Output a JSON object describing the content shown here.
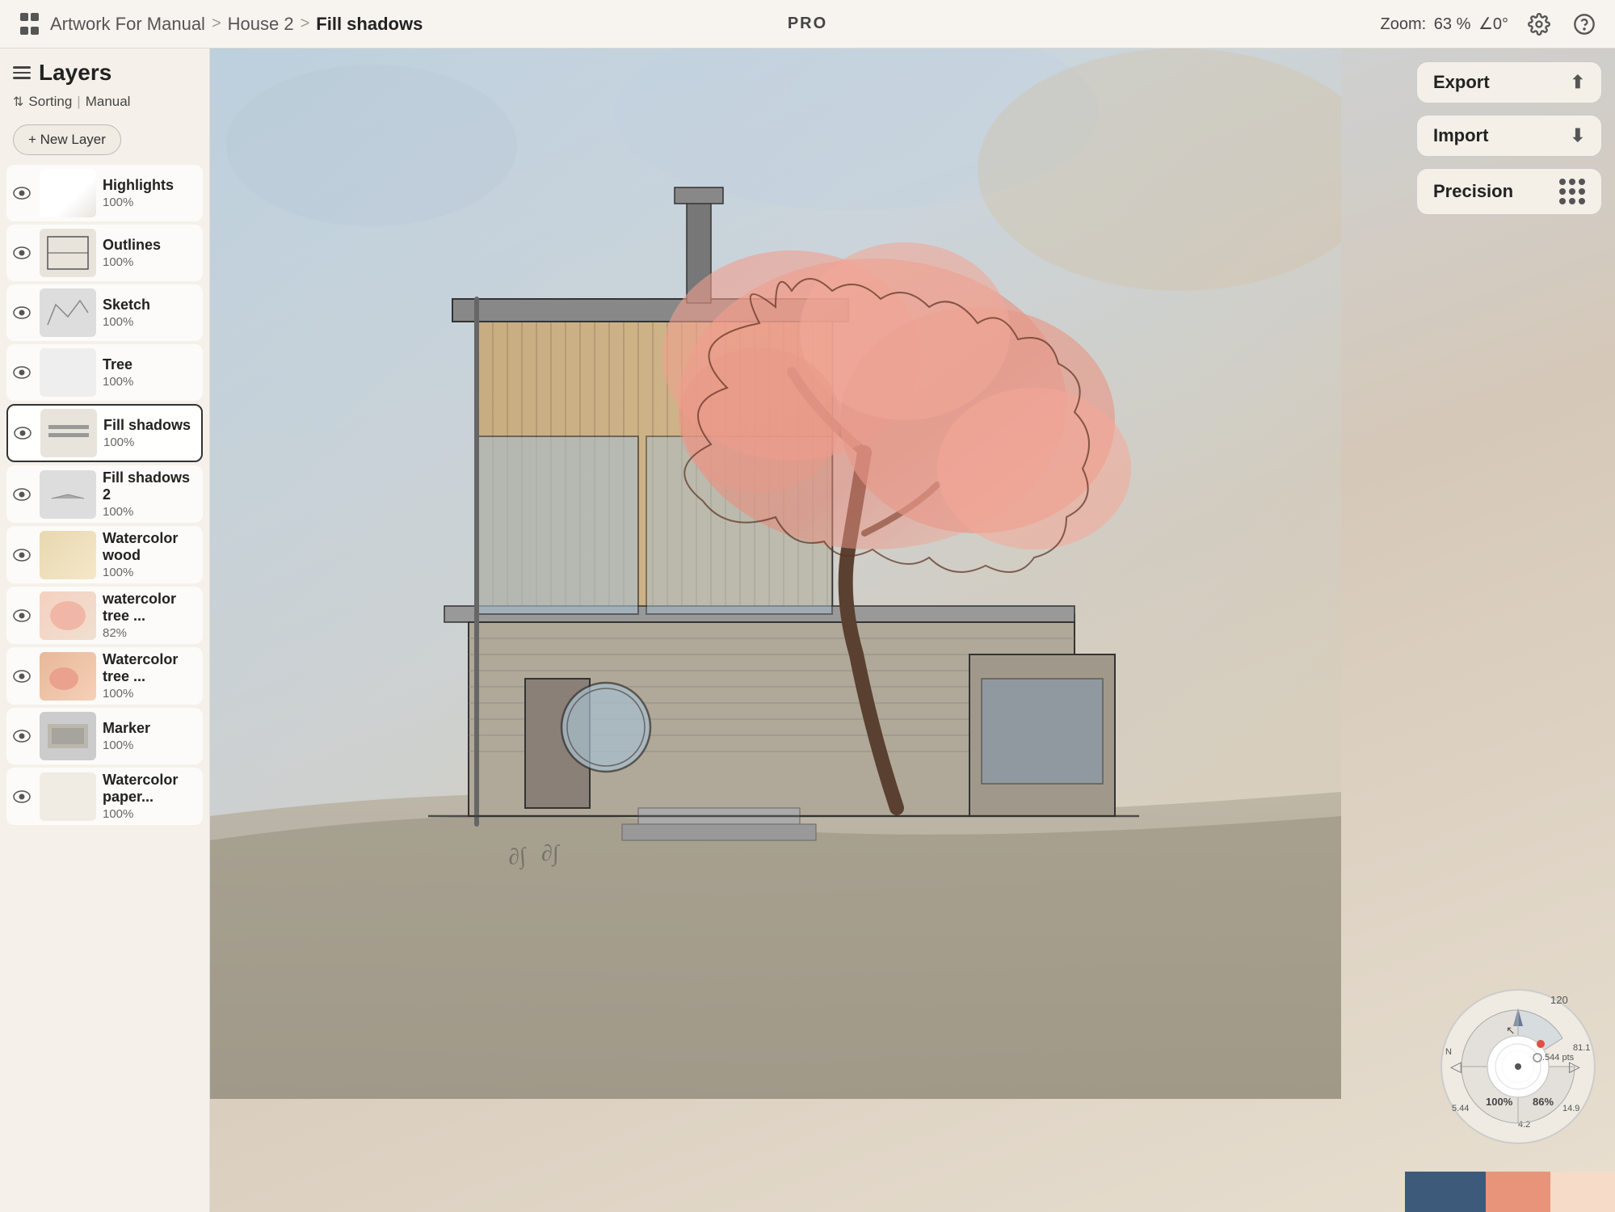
{
  "header": {
    "breadcrumb": {
      "app_icon": "grid-icon",
      "project": "Artwork For Manual",
      "separator1": ">",
      "folder": "House 2",
      "separator2": ">",
      "current": "Fill shadows"
    },
    "pro_label": "PRO",
    "zoom_label": "Zoom:",
    "zoom_value": "63 %",
    "zoom_angle": "∠0°",
    "gear_icon": "gear-icon",
    "help_icon": "help-icon"
  },
  "sidebar": {
    "title": "Layers",
    "sorting_label": "Sorting",
    "sorting_divider": "|",
    "sorting_mode": "Manual",
    "new_layer_label": "+ New Layer",
    "layers": [
      {
        "id": "highlights",
        "name": "Highlights",
        "opacity": "100%",
        "visible": true,
        "active": false,
        "thumb": "highlights"
      },
      {
        "id": "outlines",
        "name": "Outlines",
        "opacity": "100%",
        "visible": true,
        "active": false,
        "thumb": "outlines"
      },
      {
        "id": "sketch",
        "name": "Sketch",
        "opacity": "100%",
        "visible": true,
        "active": false,
        "thumb": "sketch"
      },
      {
        "id": "tree",
        "name": "Tree",
        "opacity": "100%",
        "visible": true,
        "active": false,
        "thumb": "tree"
      },
      {
        "id": "fill-shadows",
        "name": "Fill shadows",
        "opacity": "100%",
        "visible": true,
        "active": true,
        "thumb": "fillshadows"
      },
      {
        "id": "fill-shadows-2",
        "name": "Fill shadows 2",
        "opacity": "100%",
        "visible": true,
        "active": false,
        "thumb": "fillshadows2"
      },
      {
        "id": "watercolor-wood",
        "name": "Watercolor wood",
        "opacity": "100%",
        "visible": true,
        "active": false,
        "thumb": "wcwood"
      },
      {
        "id": "watercolor-tree",
        "name": "watercolor tree ...",
        "opacity": "82%",
        "visible": true,
        "active": false,
        "thumb": "wctree"
      },
      {
        "id": "watercolor-tree-2",
        "name": "Watercolor tree ...",
        "opacity": "100%",
        "visible": true,
        "active": false,
        "thumb": "wctree2"
      },
      {
        "id": "marker",
        "name": "Marker",
        "opacity": "100%",
        "visible": true,
        "active": false,
        "thumb": "marker"
      },
      {
        "id": "watercolor-paper",
        "name": "Watercolor paper...",
        "opacity": "100%",
        "visible": true,
        "active": false,
        "thumb": "wcpaper"
      }
    ]
  },
  "right_panel": {
    "export_label": "Export",
    "import_label": "Import",
    "precision_label": "Precision"
  },
  "canvas": {
    "description": "House architectural sketch with watercolor tree"
  },
  "wheel": {
    "value_pts": ".544 pts",
    "value_1": "100%",
    "value_2": "86%",
    "numbers": [
      "120",
      "81.1",
      "5.44",
      "14.9",
      "4.2"
    ]
  },
  "colors": [
    {
      "id": "blue",
      "hex": "#3d5a7a"
    },
    {
      "id": "salmon",
      "hex": "#e8947a"
    },
    {
      "id": "light-peach",
      "hex": "#f5dbc8"
    }
  ]
}
